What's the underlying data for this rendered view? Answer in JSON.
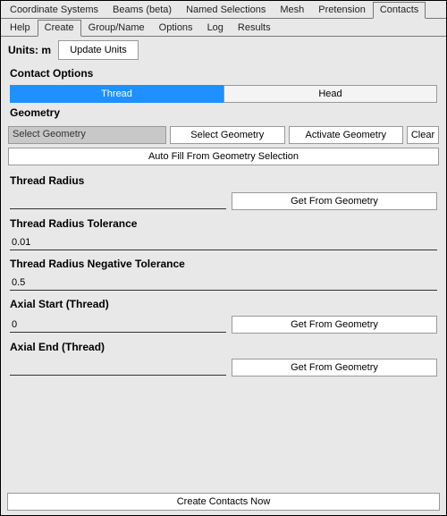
{
  "topTabs": {
    "items": [
      {
        "label": "Coordinate Systems"
      },
      {
        "label": "Beams (beta)"
      },
      {
        "label": "Named Selections"
      },
      {
        "label": "Mesh"
      },
      {
        "label": "Pretension"
      },
      {
        "label": "Contacts"
      }
    ],
    "activeIndex": 5
  },
  "subTabs": {
    "items": [
      {
        "label": "Help"
      },
      {
        "label": "Create"
      },
      {
        "label": "Group/Name"
      },
      {
        "label": "Options"
      },
      {
        "label": "Log"
      },
      {
        "label": "Results"
      }
    ],
    "activeIndex": 1
  },
  "units": {
    "label": "Units: m",
    "update_btn": "Update Units"
  },
  "contactOptions": {
    "title": "Contact Options",
    "segments": {
      "thread": "Thread",
      "head": "Head"
    }
  },
  "geometry": {
    "title": "Geometry",
    "select_placeholder": "Select Geometry",
    "select_btn": "Select Geometry",
    "activate_btn": "Activate Geometry",
    "clear_btn": "Clear",
    "autofill_btn": "Auto Fill From Geometry Selection"
  },
  "fields": {
    "thread_radius": {
      "label": "Thread Radius",
      "value": "",
      "getfrom": "Get From Geometry"
    },
    "thread_radius_tol": {
      "label": "Thread Radius Tolerance",
      "value": "0.01"
    },
    "thread_radius_neg_tol": {
      "label": "Thread Radius Negative Tolerance",
      "value": "0.5"
    },
    "axial_start": {
      "label": "Axial Start (Thread)",
      "value": "0",
      "getfrom": "Get From Geometry"
    },
    "axial_end": {
      "label": "Axial End (Thread)",
      "value": "",
      "getfrom": "Get From Geometry"
    }
  },
  "footer": {
    "create_btn": "Create Contacts Now"
  }
}
